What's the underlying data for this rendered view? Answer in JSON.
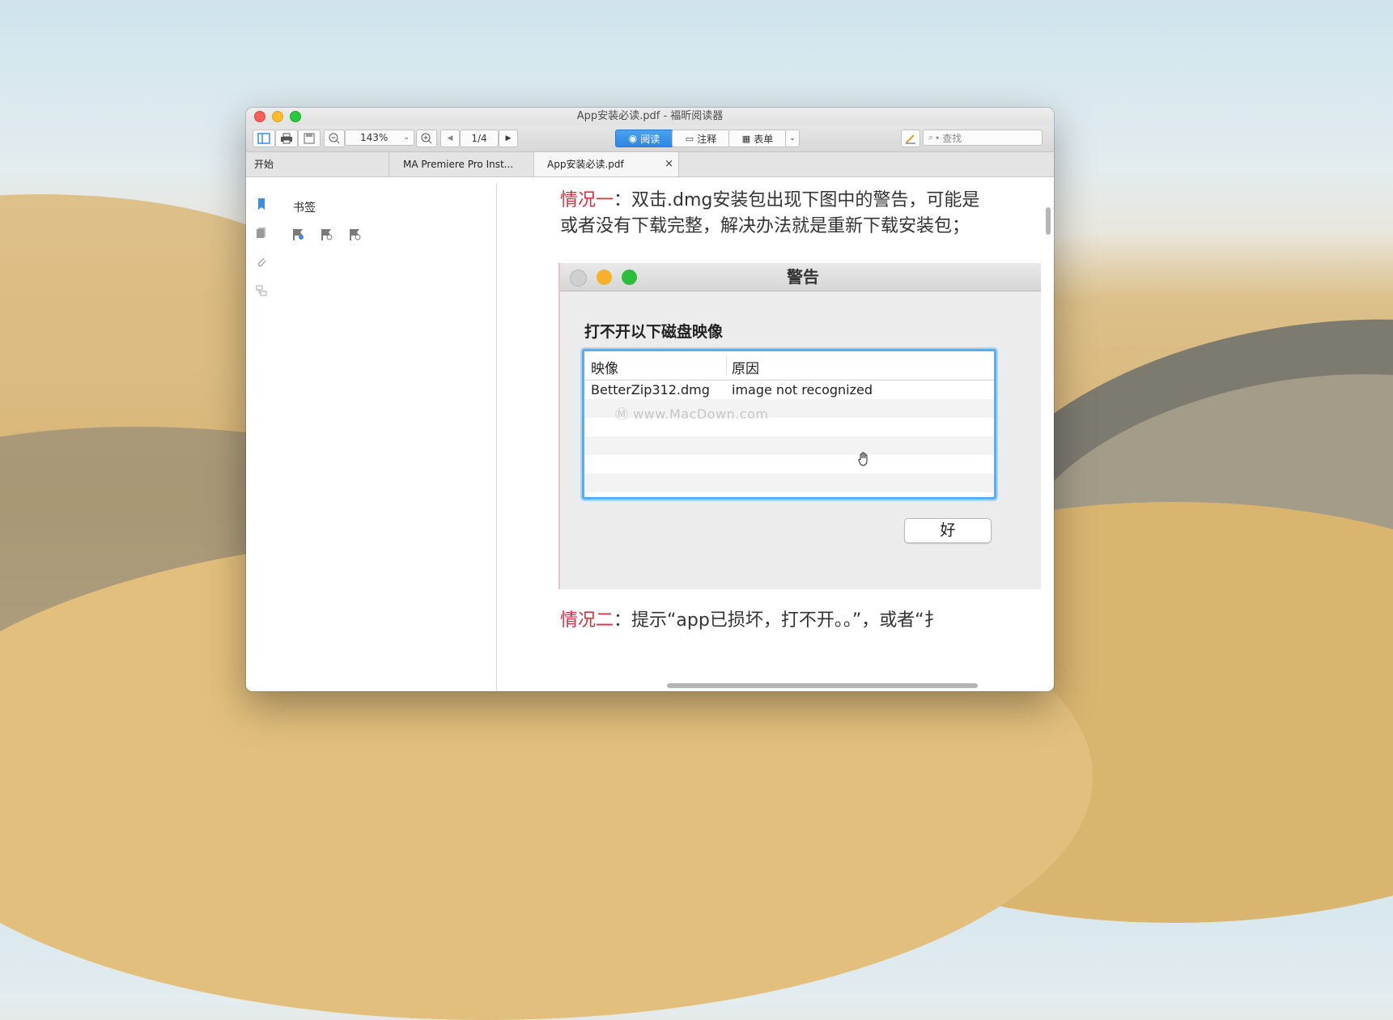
{
  "window": {
    "title": "App安装必读.pdf - 福昕阅读器"
  },
  "toolbar": {
    "zoom": "143%",
    "page": "1/4",
    "modes": {
      "read": "阅读",
      "comment": "注释",
      "form": "表单"
    },
    "search_placeholder": "查找"
  },
  "tabs": [
    {
      "label": "开始"
    },
    {
      "label": "MA Premiere Pro Inst..."
    },
    {
      "label": "App安装必读.pdf"
    }
  ],
  "tab_close": "×",
  "bookmark_panel": {
    "title": "书签"
  },
  "document": {
    "para1": {
      "tag": "情况一",
      "line1": "：双击.dmg安装包出现下图中的警告，可能是",
      "line2": "或者没有下载完整，解决办法就是重新下载安装包；"
    },
    "para2": {
      "tag": "情况二",
      "line1": "：提示“app已损坏，打不开。。”，或者“扌"
    }
  },
  "embedded_dialog": {
    "title": "警告",
    "heading": "打不开以下磁盘映像",
    "columns": [
      "映像",
      "原因"
    ],
    "rows": [
      {
        "image": "BetterZip312.dmg",
        "reason": "image not recognized"
      }
    ],
    "watermark": "www.MacDown.com",
    "ok_label": "好"
  }
}
